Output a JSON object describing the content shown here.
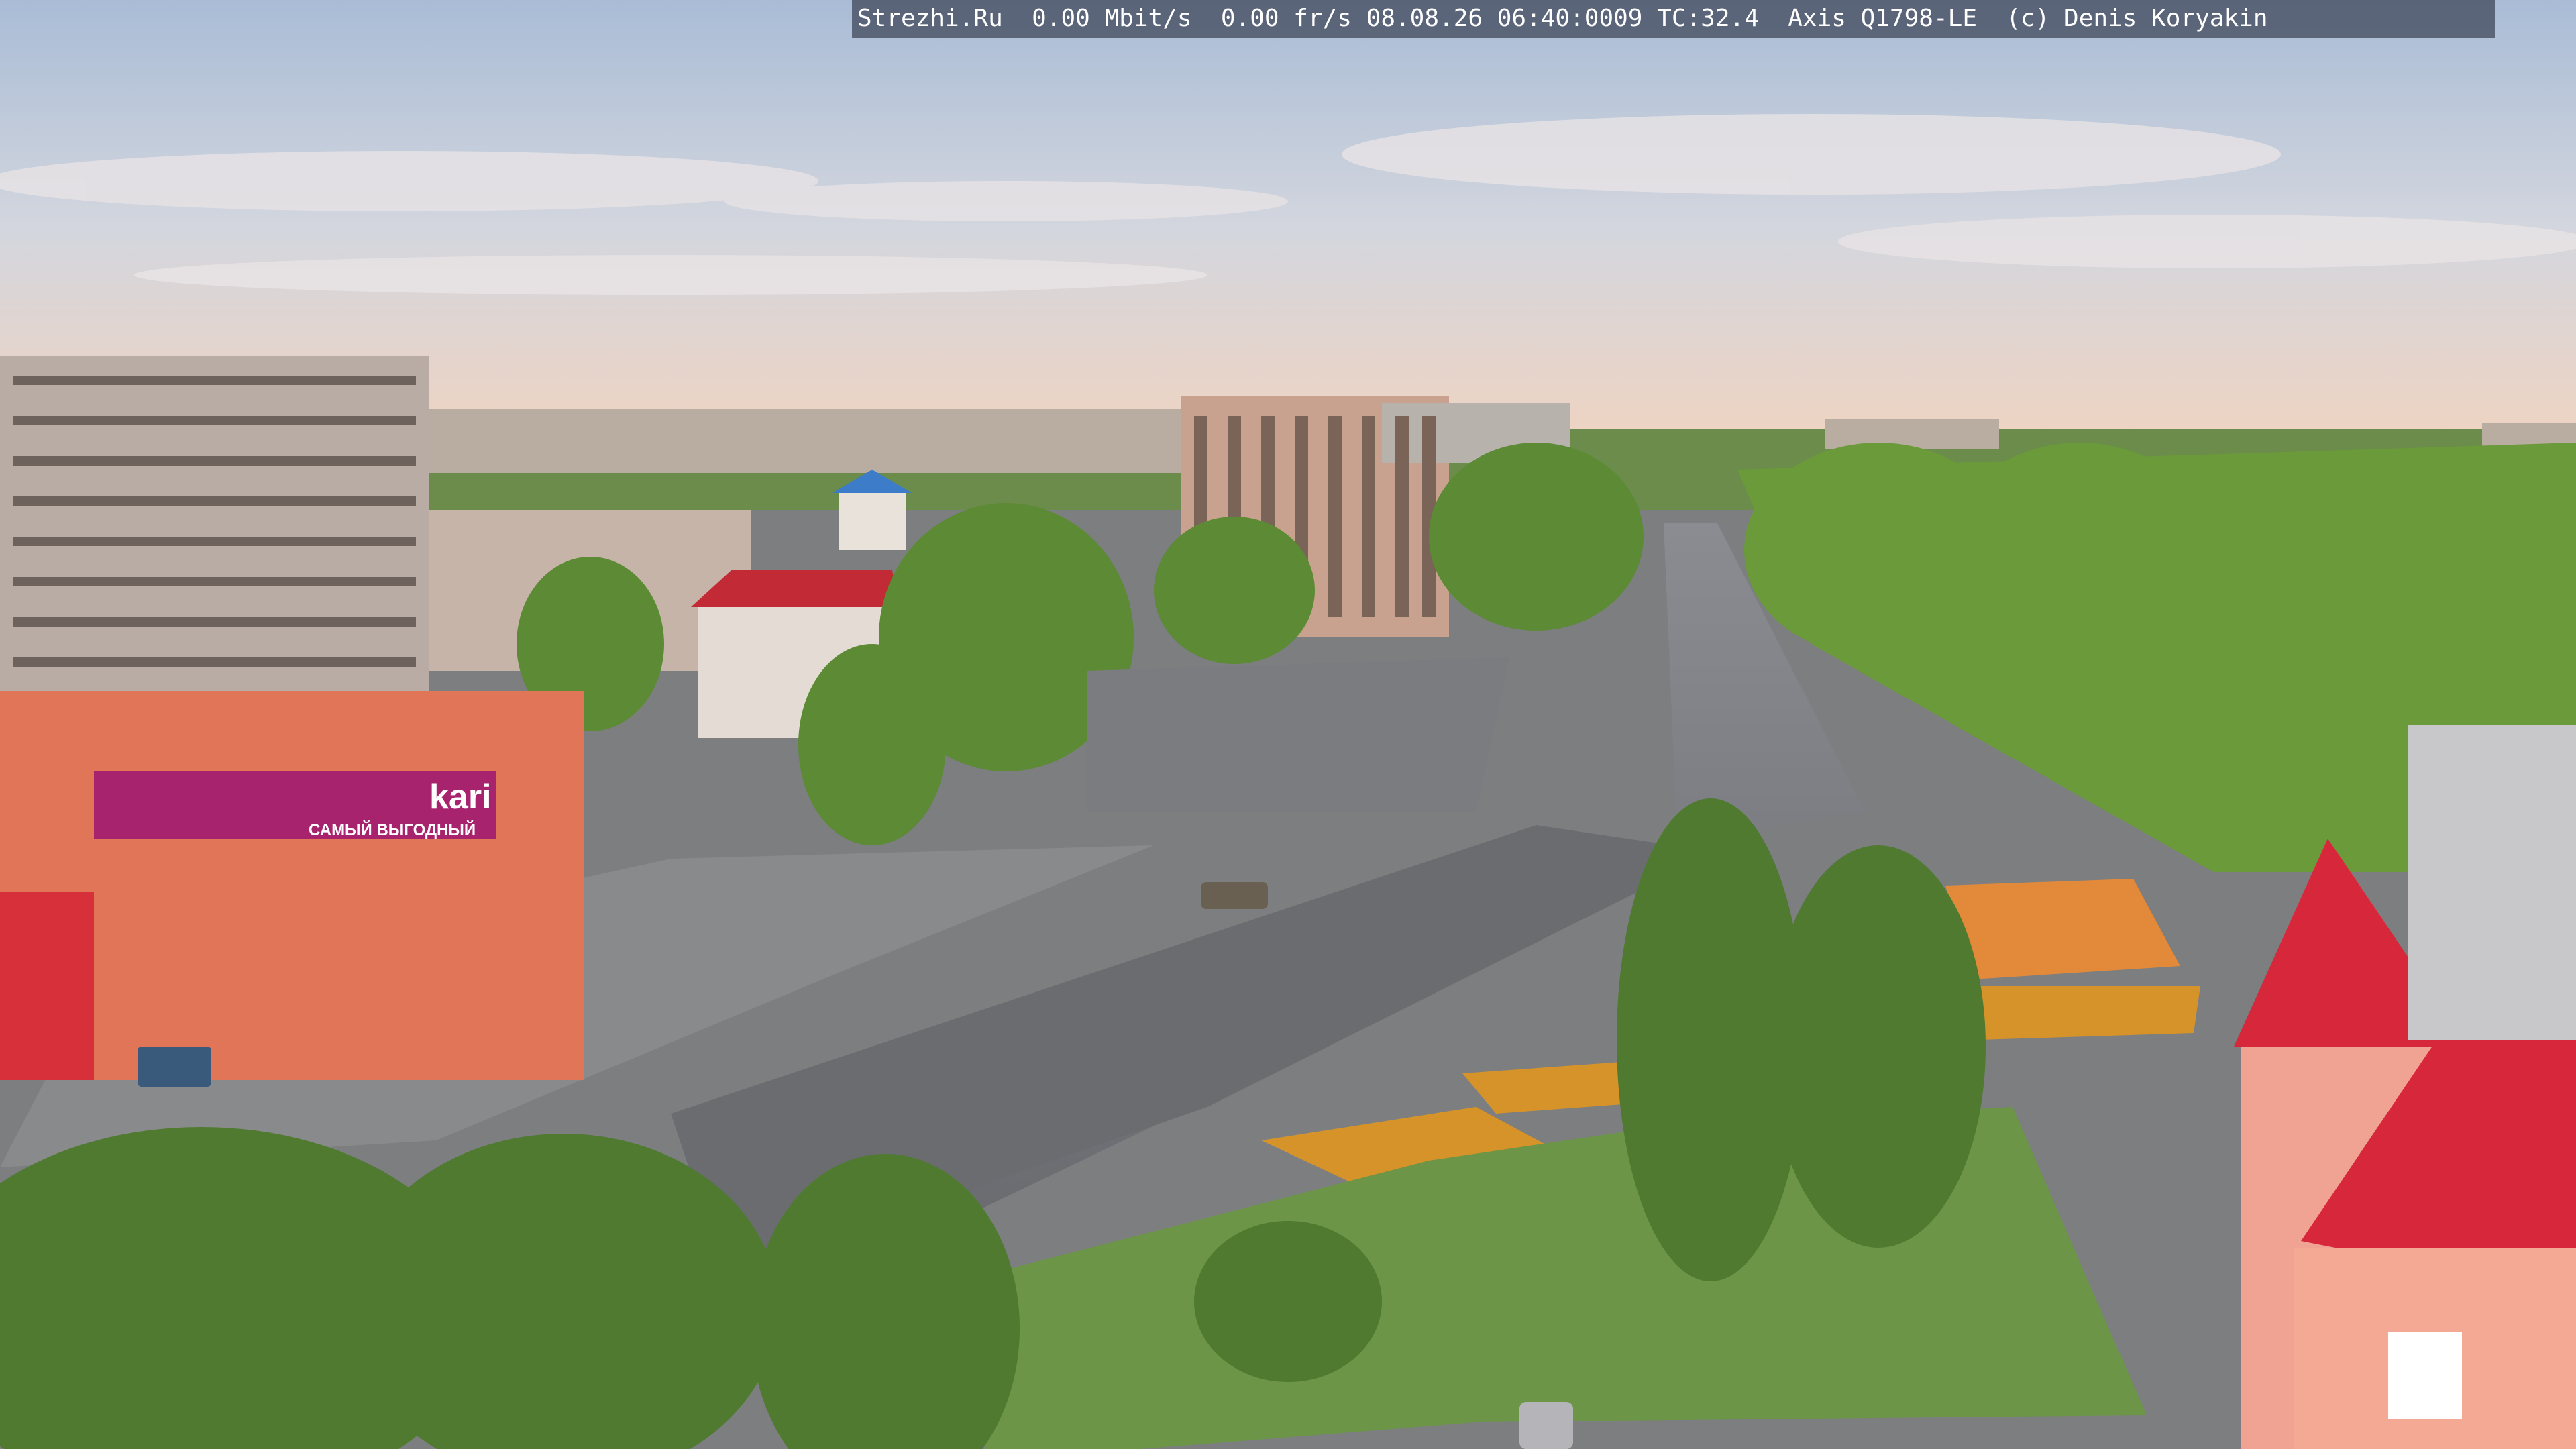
{
  "camera_overlay": {
    "site": "Strezhi.Ru",
    "bitrate": "0.00 Mbit/s",
    "framerate": "0.00 fr/s",
    "timestamp": "08.08.26 06:40:0009",
    "temperature": "TC:32.4",
    "camera_model": "Axis Q1798-LE",
    "copyright": "(c) Denis Koryakin"
  },
  "storefront": {
    "brand": "kari",
    "banner_text": "САМЫЙ ВЫГОДНЫЙ",
    "sign_small": "kari"
  },
  "colors": {
    "sky_top": "#aebfd6",
    "sky_horizon": "#f0d6c4",
    "foliage": "#5f8a38",
    "road": "#6e6f73",
    "roof_red": "#d2283a",
    "brand_magenta": "#a8236e"
  }
}
